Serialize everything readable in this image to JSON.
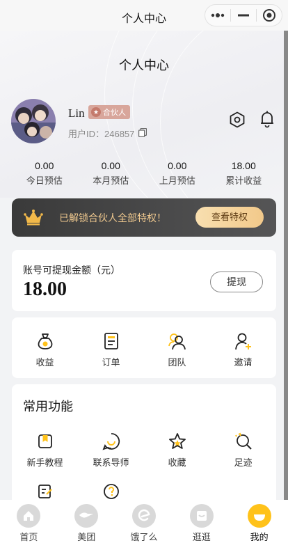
{
  "topbar": {
    "title": "个人中心"
  },
  "page": {
    "title": "个人中心"
  },
  "user": {
    "name": "Lin",
    "badge": "合伙人",
    "id_label": "用户ID：",
    "id_value": "246857"
  },
  "stats": [
    {
      "value": "0.00",
      "label": "今日预估"
    },
    {
      "value": "0.00",
      "label": "本月预估"
    },
    {
      "value": "0.00",
      "label": "上月预估"
    },
    {
      "value": "18.00",
      "label": "累计收益"
    }
  ],
  "vip_banner": {
    "text": "已解锁合伙人全部特权！",
    "button": "查看特权"
  },
  "balance": {
    "label": "账号可提现金额（元）",
    "amount": "18.00",
    "withdraw": "提现"
  },
  "quick": [
    {
      "label": "收益",
      "icon": "money-bag-icon"
    },
    {
      "label": "订单",
      "icon": "order-icon"
    },
    {
      "label": "团队",
      "icon": "team-icon"
    },
    {
      "label": "邀请",
      "icon": "invite-icon"
    }
  ],
  "common": {
    "title": "常用功能",
    "items": [
      {
        "label": "新手教程",
        "icon": "tutorial-icon"
      },
      {
        "label": "联系导师",
        "icon": "contact-mentor-icon"
      },
      {
        "label": "收藏",
        "icon": "star-icon"
      },
      {
        "label": "足迹",
        "icon": "footprint-icon"
      },
      {
        "label": "",
        "icon": "feedback-icon"
      },
      {
        "label": "",
        "icon": "help-icon"
      }
    ]
  },
  "tabbar": [
    {
      "label": "首页",
      "icon": "home-icon",
      "active": false
    },
    {
      "label": "美团",
      "icon": "meituan-icon",
      "active": false
    },
    {
      "label": "饿了么",
      "icon": "eleme-icon",
      "active": false
    },
    {
      "label": "逛逛",
      "icon": "browse-icon",
      "active": false
    },
    {
      "label": "我的",
      "icon": "profile-icon",
      "active": true
    }
  ],
  "colors": {
    "accent": "#ffc21a",
    "gold_text": "#f0c98f",
    "badge": "#d8a69b"
  }
}
